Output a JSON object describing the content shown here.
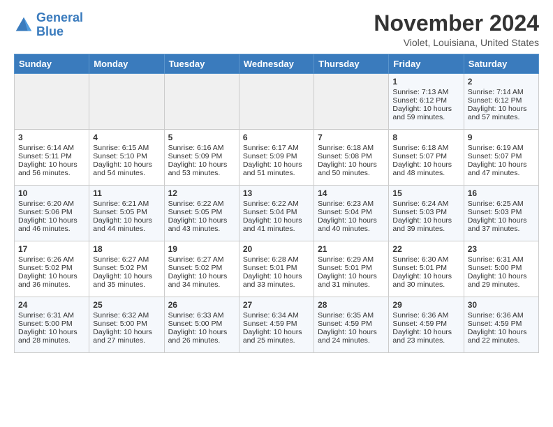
{
  "logo": {
    "line1": "General",
    "line2": "Blue"
  },
  "title": "November 2024",
  "subtitle": "Violet, Louisiana, United States",
  "weekdays": [
    "Sunday",
    "Monday",
    "Tuesday",
    "Wednesday",
    "Thursday",
    "Friday",
    "Saturday"
  ],
  "weeks": [
    [
      {
        "day": "",
        "info": ""
      },
      {
        "day": "",
        "info": ""
      },
      {
        "day": "",
        "info": ""
      },
      {
        "day": "",
        "info": ""
      },
      {
        "day": "",
        "info": ""
      },
      {
        "day": "1",
        "info": "Sunrise: 7:13 AM\nSunset: 6:12 PM\nDaylight: 10 hours and 59 minutes."
      },
      {
        "day": "2",
        "info": "Sunrise: 7:14 AM\nSunset: 6:12 PM\nDaylight: 10 hours and 57 minutes."
      }
    ],
    [
      {
        "day": "3",
        "info": "Sunrise: 6:14 AM\nSunset: 5:11 PM\nDaylight: 10 hours and 56 minutes."
      },
      {
        "day": "4",
        "info": "Sunrise: 6:15 AM\nSunset: 5:10 PM\nDaylight: 10 hours and 54 minutes."
      },
      {
        "day": "5",
        "info": "Sunrise: 6:16 AM\nSunset: 5:09 PM\nDaylight: 10 hours and 53 minutes."
      },
      {
        "day": "6",
        "info": "Sunrise: 6:17 AM\nSunset: 5:09 PM\nDaylight: 10 hours and 51 minutes."
      },
      {
        "day": "7",
        "info": "Sunrise: 6:18 AM\nSunset: 5:08 PM\nDaylight: 10 hours and 50 minutes."
      },
      {
        "day": "8",
        "info": "Sunrise: 6:18 AM\nSunset: 5:07 PM\nDaylight: 10 hours and 48 minutes."
      },
      {
        "day": "9",
        "info": "Sunrise: 6:19 AM\nSunset: 5:07 PM\nDaylight: 10 hours and 47 minutes."
      }
    ],
    [
      {
        "day": "10",
        "info": "Sunrise: 6:20 AM\nSunset: 5:06 PM\nDaylight: 10 hours and 46 minutes."
      },
      {
        "day": "11",
        "info": "Sunrise: 6:21 AM\nSunset: 5:05 PM\nDaylight: 10 hours and 44 minutes."
      },
      {
        "day": "12",
        "info": "Sunrise: 6:22 AM\nSunset: 5:05 PM\nDaylight: 10 hours and 43 minutes."
      },
      {
        "day": "13",
        "info": "Sunrise: 6:22 AM\nSunset: 5:04 PM\nDaylight: 10 hours and 41 minutes."
      },
      {
        "day": "14",
        "info": "Sunrise: 6:23 AM\nSunset: 5:04 PM\nDaylight: 10 hours and 40 minutes."
      },
      {
        "day": "15",
        "info": "Sunrise: 6:24 AM\nSunset: 5:03 PM\nDaylight: 10 hours and 39 minutes."
      },
      {
        "day": "16",
        "info": "Sunrise: 6:25 AM\nSunset: 5:03 PM\nDaylight: 10 hours and 37 minutes."
      }
    ],
    [
      {
        "day": "17",
        "info": "Sunrise: 6:26 AM\nSunset: 5:02 PM\nDaylight: 10 hours and 36 minutes."
      },
      {
        "day": "18",
        "info": "Sunrise: 6:27 AM\nSunset: 5:02 PM\nDaylight: 10 hours and 35 minutes."
      },
      {
        "day": "19",
        "info": "Sunrise: 6:27 AM\nSunset: 5:02 PM\nDaylight: 10 hours and 34 minutes."
      },
      {
        "day": "20",
        "info": "Sunrise: 6:28 AM\nSunset: 5:01 PM\nDaylight: 10 hours and 33 minutes."
      },
      {
        "day": "21",
        "info": "Sunrise: 6:29 AM\nSunset: 5:01 PM\nDaylight: 10 hours and 31 minutes."
      },
      {
        "day": "22",
        "info": "Sunrise: 6:30 AM\nSunset: 5:01 PM\nDaylight: 10 hours and 30 minutes."
      },
      {
        "day": "23",
        "info": "Sunrise: 6:31 AM\nSunset: 5:00 PM\nDaylight: 10 hours and 29 minutes."
      }
    ],
    [
      {
        "day": "24",
        "info": "Sunrise: 6:31 AM\nSunset: 5:00 PM\nDaylight: 10 hours and 28 minutes."
      },
      {
        "day": "25",
        "info": "Sunrise: 6:32 AM\nSunset: 5:00 PM\nDaylight: 10 hours and 27 minutes."
      },
      {
        "day": "26",
        "info": "Sunrise: 6:33 AM\nSunset: 5:00 PM\nDaylight: 10 hours and 26 minutes."
      },
      {
        "day": "27",
        "info": "Sunrise: 6:34 AM\nSunset: 4:59 PM\nDaylight: 10 hours and 25 minutes."
      },
      {
        "day": "28",
        "info": "Sunrise: 6:35 AM\nSunset: 4:59 PM\nDaylight: 10 hours and 24 minutes."
      },
      {
        "day": "29",
        "info": "Sunrise: 6:36 AM\nSunset: 4:59 PM\nDaylight: 10 hours and 23 minutes."
      },
      {
        "day": "30",
        "info": "Sunrise: 6:36 AM\nSunset: 4:59 PM\nDaylight: 10 hours and 22 minutes."
      }
    ]
  ]
}
